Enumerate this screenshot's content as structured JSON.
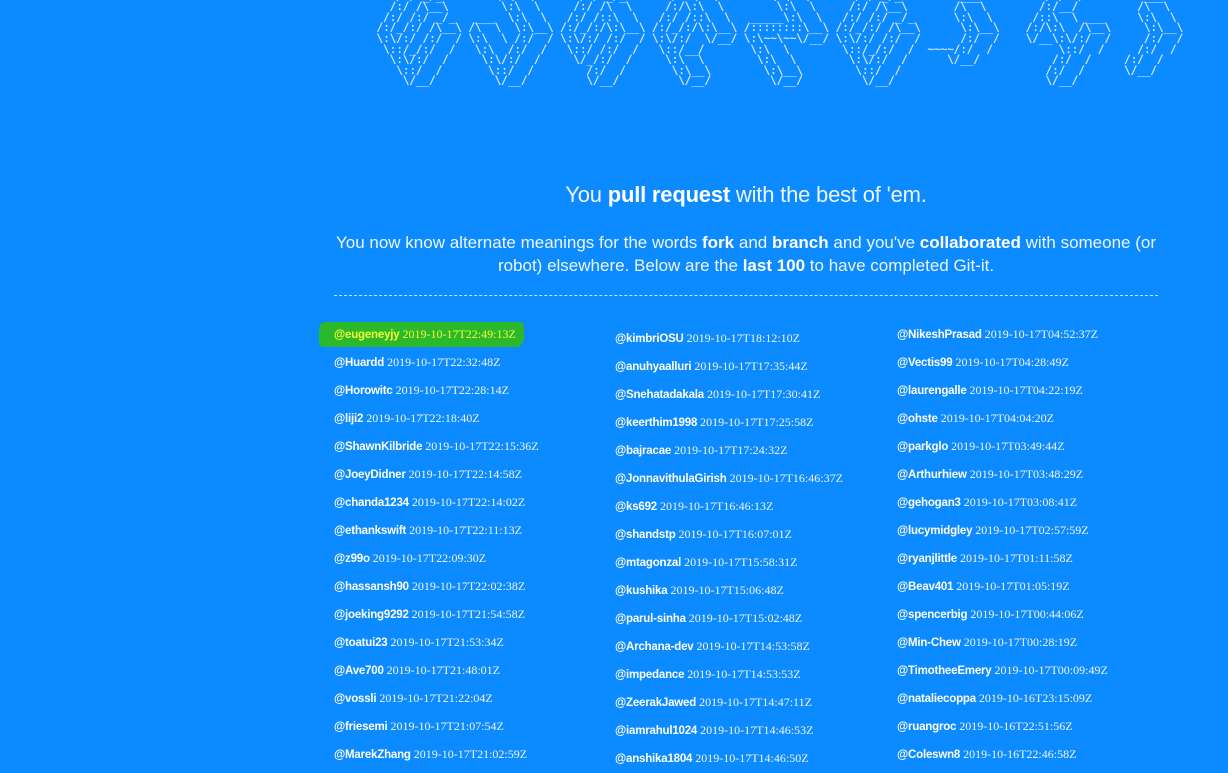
{
  "banner": {
    "ascii": "     /\\__\\         /\\  \\         /\\__\\         /\\  \\         /\\  \\         /\\__\\                        /\\__\\                  \n    /:/ _/_        \\:\\  \\       /:/ _/_       /::\\  \\        \\:\\  \\       /:/ _/_         ___          /:/  /         ___      \n   /:/ /\\__\\        \\:\\  \\     /:/ /\\  \\     /:/\\:\\  \\        \\:\\  \\     /:/ /\\__\\       /\\  \\        /:/__/         /\\  \\     \n  /:/ /:/ _/_   ___  \\:\\  \\   /:/ /::\\  \\   /:/ /::\\  \\   _____\\:\\  \\   /:/ /:/ _/_      \\:\\  \\      /::\\  \\ ___     \\:\\  \\    \n /:/_/:/ /\\__\\ /\\  \\  \\:\\__\\ /:/_/:/\\:\\__\\ /:/_/:/\\:\\__\\ /::::::::\\__\\ /:/_/:/ /\\__\\      \\:\\__\\    /:/\\:\\  /\\__\\     \\:\\__\\   \n \\:\\/:/ /:/  / \\:\\  \\ /:/  / \\:\\/:/ /:/  / \\:\\/:/  \\/__/ \\:\\~~\\~~\\/__/ \\:\\/:/ /:/  /      /:/  /    \\/__\\:\\/:/  /     /:/  /   \n  \\::/_/:/  /   \\:\\  /:/  /   \\::/ /:/  /   \\::/__/       \\:\\  \\        \\::/_/:/  /  ~~~~/:/  /          \\::/  /     /:/  /    \n   \\:\\/:/  /     \\:\\/:/  /     \\/_/:/  /     \\:\\  \\        \\:\\  \\        \\:\\/:/  /      \\/__/           /:/  /     /:/  /     \n    \\::/  /       \\::/  /        /:/  /       \\:\\__\\        \\:\\__\\        \\::/  /                      /:/  /      \\/__/      \n     \\/__/         \\/__/         \\/__/         \\/__/         \\/__/         \\/__/                       \\/__/                   "
  },
  "headline": {
    "pre": "You ",
    "bold": "pull request",
    "post": " with the best of 'em."
  },
  "lede": {
    "t1": "You now know alternate meanings for the words ",
    "b1": "fork",
    "t2": " and ",
    "b2": "branch",
    "t3": " and you've ",
    "b3": "collaborated",
    "t4": " with someone (or robot) elsewhere. Below are the ",
    "b4": "last 100",
    "t5": " to have completed Git-it."
  },
  "completions": {
    "col1": [
      {
        "user": "@eugeneyjy",
        "time": "2019-10-17T22:49:13Z"
      },
      {
        "user": "@Huardd",
        "time": "2019-10-17T22:32:48Z"
      },
      {
        "user": "@Horowitc",
        "time": "2019-10-17T22:28:14Z"
      },
      {
        "user": "@liji2",
        "time": "2019-10-17T22:18:40Z"
      },
      {
        "user": "@ShawnKilbride",
        "time": "2019-10-17T22:15:36Z"
      },
      {
        "user": "@JoeyDidner",
        "time": "2019-10-17T22:14:58Z"
      },
      {
        "user": "@chanda1234",
        "time": "2019-10-17T22:14:02Z"
      },
      {
        "user": "@ethankswift",
        "time": "2019-10-17T22:11:13Z"
      },
      {
        "user": "@z99o",
        "time": "2019-10-17T22:09:30Z"
      },
      {
        "user": "@hassansh90",
        "time": "2019-10-17T22:02:38Z"
      },
      {
        "user": "@joeking9292",
        "time": "2019-10-17T21:54:58Z"
      },
      {
        "user": "@toatui23",
        "time": "2019-10-17T21:53:34Z"
      },
      {
        "user": "@Ave700",
        "time": "2019-10-17T21:48:01Z"
      },
      {
        "user": "@vossli",
        "time": "2019-10-17T21:22:04Z"
      },
      {
        "user": "@friesemi",
        "time": "2019-10-17T21:07:54Z"
      },
      {
        "user": "@MarekZhang",
        "time": "2019-10-17T21:02:59Z"
      }
    ],
    "col2": [
      {
        "user": "@kimbriOSU",
        "time": "2019-10-17T18:12:10Z"
      },
      {
        "user": "@anuhyaalluri",
        "time": "2019-10-17T17:35:44Z"
      },
      {
        "user": "@Snehatadakala",
        "time": "2019-10-17T17:30:41Z"
      },
      {
        "user": "@keerthim1998",
        "time": "2019-10-17T17:25:58Z"
      },
      {
        "user": "@bajracae",
        "time": "2019-10-17T17:24:32Z"
      },
      {
        "user": "@JonnavithulaGirish",
        "time": "2019-10-17T16:46:37Z"
      },
      {
        "user": "@ks692",
        "time": "2019-10-17T16:46:13Z"
      },
      {
        "user": "@shandstp",
        "time": "2019-10-17T16:07:01Z"
      },
      {
        "user": "@mtagonzal",
        "time": "2019-10-17T15:58:31Z"
      },
      {
        "user": "@kushika",
        "time": "2019-10-17T15:06:48Z"
      },
      {
        "user": "@parul-sinha",
        "time": "2019-10-17T15:02:48Z"
      },
      {
        "user": "@Archana-dev",
        "time": "2019-10-17T14:53:58Z"
      },
      {
        "user": "@impedance",
        "time": "2019-10-17T14:53:53Z"
      },
      {
        "user": "@ZeerakJawed",
        "time": "2019-10-17T14:47:11Z"
      },
      {
        "user": "@iamrahul1024",
        "time": "2019-10-17T14:46:53Z"
      },
      {
        "user": "@anshika1804",
        "time": "2019-10-17T14:46:50Z"
      }
    ],
    "col3": [
      {
        "user": "@NikeshPrasad",
        "time": "2019-10-17T04:52:37Z"
      },
      {
        "user": "@Vectis99",
        "time": "2019-10-17T04:28:49Z"
      },
      {
        "user": "@laurengalle",
        "time": "2019-10-17T04:22:19Z"
      },
      {
        "user": "@ohste",
        "time": "2019-10-17T04:04:20Z"
      },
      {
        "user": "@parkglo",
        "time": "2019-10-17T03:49:44Z"
      },
      {
        "user": "@Arthurhiew",
        "time": "2019-10-17T03:48:29Z"
      },
      {
        "user": "@gehogan3",
        "time": "2019-10-17T03:08:41Z"
      },
      {
        "user": "@lucymidgley",
        "time": "2019-10-17T02:57:59Z"
      },
      {
        "user": "@ryanjlittle",
        "time": "2019-10-17T01:11:58Z"
      },
      {
        "user": "@Beav401",
        "time": "2019-10-17T01:05:19Z"
      },
      {
        "user": "@spencerbig",
        "time": "2019-10-17T00:44:06Z"
      },
      {
        "user": "@Min-Chew",
        "time": "2019-10-17T00:28:19Z"
      },
      {
        "user": "@TimotheeEmery",
        "time": "2019-10-17T00:09:49Z"
      },
      {
        "user": "@nataliecoppa",
        "time": "2019-10-16T23:15:09Z"
      },
      {
        "user": "@ruangroc",
        "time": "2019-10-16T22:51:56Z"
      },
      {
        "user": "@Coleswn8",
        "time": "2019-10-16T22:46:58Z"
      }
    ]
  },
  "highlight_color": "#2bb92b",
  "highlight_text_color": "#f6ff3a",
  "background_color": "#0c8aff"
}
